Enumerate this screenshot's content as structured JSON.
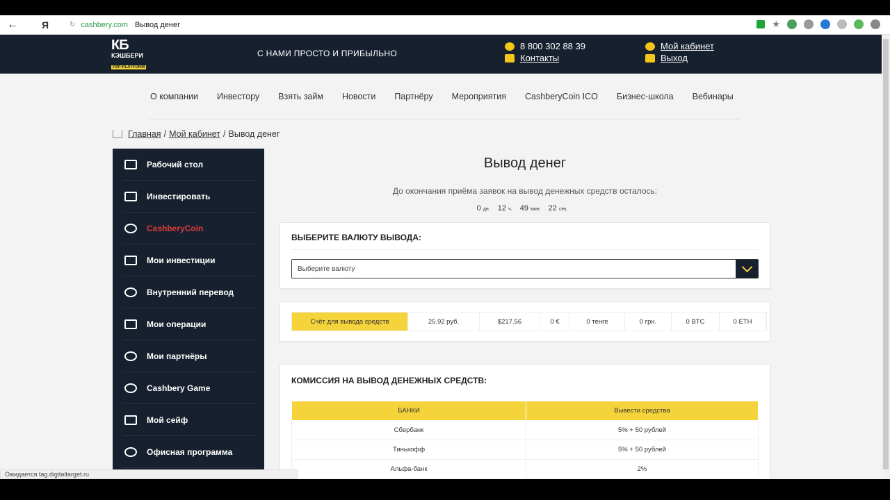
{
  "browser": {
    "domain": "cashbery.com",
    "page_title": "Вывод денег",
    "yandex_label": "Я"
  },
  "header": {
    "logo_mark": "КБ",
    "logo_brand": "КЭШБЕРИ",
    "logo_sub": "P2P-PLATFORM",
    "slogan": "С НАМИ ПРОСТО И ПРИБЫЛЬНО",
    "phone": "8 800 302 88 39",
    "contacts_link": "Контакты",
    "account_link": "Мой кабинет",
    "logout_link": "Выход"
  },
  "nav": {
    "items": [
      "О компании",
      "Инвестору",
      "Взять займ",
      "Новости",
      "Партнёру",
      "Мероприятия",
      "CashberyCoin ICO",
      "Бизнес-школа",
      "Вебинары"
    ]
  },
  "breadcrumb": {
    "home": "Главная",
    "sep1": "/",
    "cabinet": "Мой кабинет",
    "sep2": "/",
    "current": "Вывод денег"
  },
  "sidebar": {
    "items": [
      {
        "label": "Рабочий стол"
      },
      {
        "label": "Инвестировать"
      },
      {
        "label": "CashberyCoin"
      },
      {
        "label": "Мои инвестиции"
      },
      {
        "label": "Внутренний перевод"
      },
      {
        "label": "Мои операции"
      },
      {
        "label": "Мои партнёры"
      },
      {
        "label": "Cashbery Game"
      },
      {
        "label": "Мой сейф"
      },
      {
        "label": "Офисная программа"
      }
    ],
    "active_index": 2,
    "active_color": "#e23b3b"
  },
  "main": {
    "title": "Вывод денег",
    "subtitle": "До окончания приёма заявок на вывод денежных средств осталось:",
    "timer": {
      "days": "0",
      "days_unit": "дн.",
      "hours": "12",
      "hours_unit": "ч.",
      "minutes": "49",
      "minutes_unit": "мин.",
      "seconds": "22",
      "seconds_unit": "сек."
    },
    "currency_card": {
      "title": "ВЫБЕРИТЕ ВАЛЮТУ ВЫВОДА:",
      "select_value": "Выберите валюту"
    },
    "balances": [
      {
        "label": "Счёт для вывода средств",
        "width": 166
      },
      {
        "label": "25.92 руб.",
        "width": 102
      },
      {
        "label": "$217.56",
        "width": 86
      },
      {
        "label": "0 €",
        "width": 42
      },
      {
        "label": "0 тенге",
        "width": 78
      },
      {
        "label": "0 грн.",
        "width": 66
      },
      {
        "label": "0 BTC",
        "width": 68
      },
      {
        "label": "0 ETH",
        "width": 66
      }
    ],
    "commission": {
      "title": "КОМИССИЯ НА ВЫВОД ДЕНЕЖНЫХ СРЕДСТВ:",
      "headers": [
        "БАНКИ",
        "Вывести средства"
      ],
      "rows": [
        [
          "Сбербанк",
          "5% + 50 рублей"
        ],
        [
          "Тинькофф",
          "5% + 50 рублей"
        ],
        [
          "Альфа-банк",
          "2%"
        ]
      ]
    }
  },
  "status": {
    "text": "Ожидается tag.digitaltarget.ru"
  },
  "colors": {
    "dark": "#17202e",
    "accent": "#f5d33b"
  }
}
